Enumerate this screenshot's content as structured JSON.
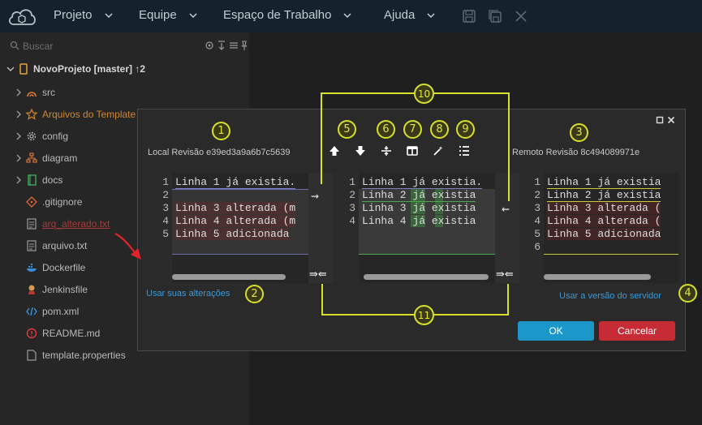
{
  "menu": {
    "items": [
      "Projeto",
      "Equipe",
      "Espaço de Trabalho",
      "Ajuda"
    ],
    "icons": [
      "save-icon",
      "save-all-icon",
      "close-icon"
    ]
  },
  "sidebar": {
    "search_placeholder": "Buscar",
    "project_label": "NovoProjeto [master] ↑2",
    "items": [
      {
        "label": "src",
        "icon": "source-icon",
        "folder": true,
        "color": "#b9b9b9"
      },
      {
        "label": "Arquivos do Template",
        "icon": "star-icon",
        "folder": true,
        "color": "#d1862f"
      },
      {
        "label": "config",
        "icon": "gear-icon",
        "folder": true,
        "color": "#b9b9b9"
      },
      {
        "label": "diagram",
        "icon": "diagram-icon",
        "folder": true,
        "color": "#b9b9b9"
      },
      {
        "label": "docs",
        "icon": "book-icon",
        "folder": true,
        "color": "#b9b9b9"
      },
      {
        "label": ".gitignore",
        "icon": "git-icon",
        "folder": false,
        "color": "#b9b9b9"
      },
      {
        "label": "arq_alterado.txt",
        "icon": "text-file-icon",
        "folder": false,
        "color": "#a83a3a"
      },
      {
        "label": "arquivo.txt",
        "icon": "text-file-icon",
        "folder": false,
        "color": "#b9b9b9"
      },
      {
        "label": "Dockerfile",
        "icon": "docker-icon",
        "folder": false,
        "color": "#b9b9b9"
      },
      {
        "label": "Jenkinsfile",
        "icon": "jenkins-icon",
        "folder": false,
        "color": "#b9b9b9"
      },
      {
        "label": "pom.xml",
        "icon": "xml-icon",
        "folder": false,
        "color": "#b9b9b9"
      },
      {
        "label": "README.md",
        "icon": "readme-icon",
        "folder": false,
        "color": "#b9b9b9"
      },
      {
        "label": "template.properties",
        "icon": "file-icon",
        "folder": false,
        "color": "#b9b9b9"
      }
    ]
  },
  "dialog": {
    "local_label": "Local Revisão e39ed3a9a6b7c5639",
    "remote_label": "Remoto Revisão 8c494089971e",
    "use_local": "Usar suas alterações",
    "use_remote": "Usar a versão do servidor",
    "ok": "OK",
    "cancel": "Cancelar",
    "left_lines": [
      {
        "num": "1",
        "text": "Linha 1 já existia."
      },
      {
        "num": "2",
        "text": ""
      },
      {
        "num": "3",
        "text": "Linha 3 alterada (m"
      },
      {
        "num": "4",
        "text": "Linha 4 alterada (m"
      },
      {
        "num": "5",
        "text": "Linha 5 adicionada"
      }
    ],
    "middle_lines": [
      {
        "num": "1",
        "text": "Linha 1 já existia."
      },
      {
        "num": "2",
        "text": "Linha 2 já existia"
      },
      {
        "num": "3",
        "text": "Linha 3 já existia"
      },
      {
        "num": "4",
        "text": "Linha 4 já existia"
      }
    ],
    "right_lines": [
      {
        "num": "1",
        "text": "Linha 1 já existia"
      },
      {
        "num": "2",
        "text": "Linha 2 já existia"
      },
      {
        "num": "3",
        "text": "Linha 3 alterada ("
      },
      {
        "num": "4",
        "text": "Linha 4 alterada ("
      },
      {
        "num": "5",
        "text": "Linha 5 adicionada"
      },
      {
        "num": "6",
        "text": ""
      }
    ],
    "tools": [
      "arrow-up-icon",
      "arrow-down-icon",
      "split-icon",
      "columns-icon",
      "magic-wand-icon",
      "list-icon"
    ]
  },
  "callouts": [
    "1",
    "2",
    "3",
    "4",
    "5",
    "6",
    "7",
    "8",
    "9",
    "10",
    "11"
  ],
  "colors": {
    "menubar": "#13222c",
    "accent": "#1b97c9",
    "cancel": "#c62b36",
    "callout": "#d8df2a",
    "link": "#3b9ad9"
  }
}
